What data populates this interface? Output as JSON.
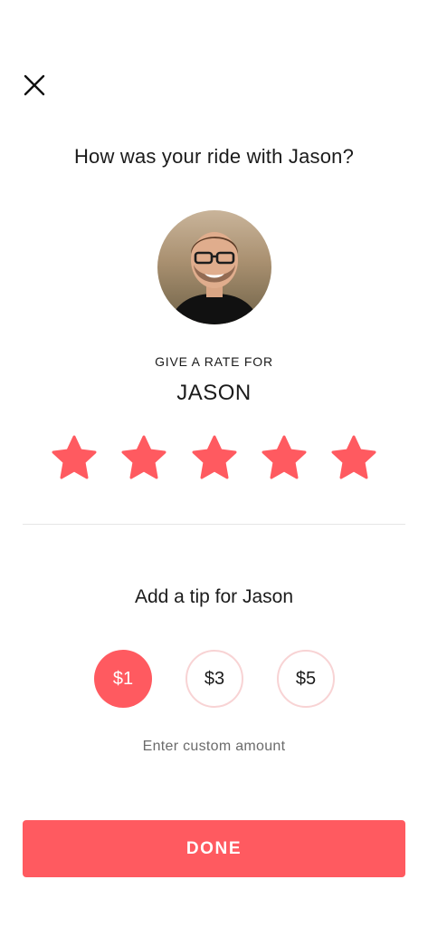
{
  "header": {
    "question": "How was your ride with Jason?"
  },
  "driver": {
    "avatar_icon": "driver-avatar-photo",
    "rate_label": "GIVE A RATE FOR",
    "name": "JASON"
  },
  "rating": {
    "value": 5,
    "max": 5,
    "star_color": "#ff5a60"
  },
  "tip": {
    "title": "Add a tip for Jason",
    "options": [
      "$1",
      "$3",
      "$5"
    ],
    "selected": "$1",
    "custom_amount_label": "Enter custom amount"
  },
  "actions": {
    "done_label": "DONE"
  },
  "colors": {
    "accent": "#ff5a60",
    "unselected_border": "#f8d3d4"
  }
}
